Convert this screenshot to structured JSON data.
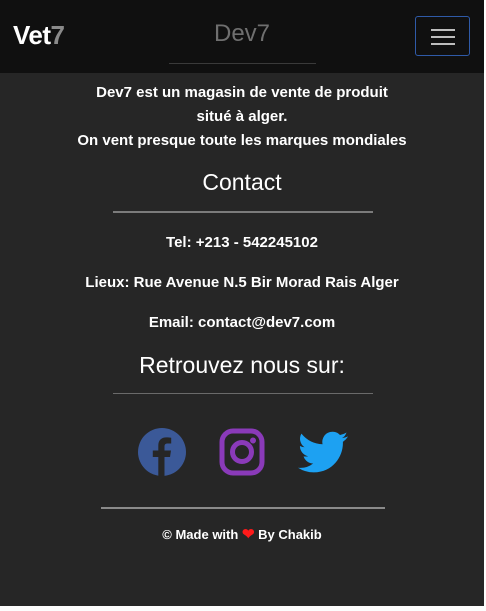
{
  "navbar": {
    "brand_text": "Vet",
    "brand_number": "7",
    "title": "Dev7",
    "menu_toggle_label": "Toggle navigation"
  },
  "about": {
    "line1": "Dev7 est un magasin de vente de produit",
    "line2": "situé à alger.",
    "line3": "On vent presque toute les marques mondiales"
  },
  "contact": {
    "heading": "Contact",
    "phone": "Tel: +213 - 542245102",
    "address": "Lieux: Rue Avenue N.5 Bir Morad Rais Alger",
    "email": "Email: contact@dev7.com"
  },
  "social": {
    "heading": "Retrouvez nous sur:",
    "icons": [
      "facebook-icon",
      "instagram-icon",
      "twitter-icon"
    ],
    "colors": {
      "facebook": "#3b5998",
      "instagram": "#8a3ab9",
      "twitter": "#1da1f2"
    }
  },
  "footer": {
    "prefix": "© Made with",
    "suffix": "By Chakib",
    "heart_color": "#ff1a1a"
  },
  "colors": {
    "navbar_bg": "#101010",
    "page_bg": "#262626",
    "toggler_border": "#2f5aa8"
  }
}
